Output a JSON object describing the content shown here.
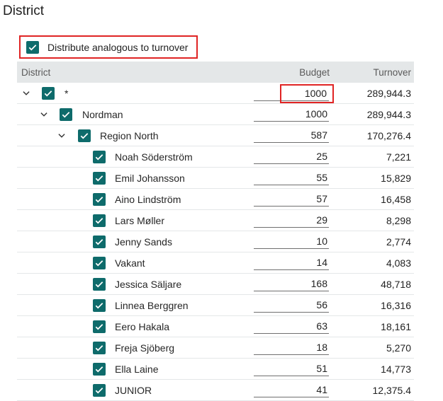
{
  "page": {
    "title": "District"
  },
  "distribute": {
    "label": "Distribute analogous to turnover",
    "checked": true
  },
  "grid": {
    "columns": {
      "district": "District",
      "budget": "Budget",
      "turnover": "Turnover"
    },
    "rows": [
      {
        "name": "*",
        "budget": "1000",
        "turnover": "289,944.3",
        "level": 0,
        "expandable": true,
        "checked": true,
        "highlight": true
      },
      {
        "name": "Nordman",
        "budget": "1000",
        "turnover": "289,944.3",
        "level": 1,
        "expandable": true,
        "checked": true
      },
      {
        "name": "Region North",
        "budget": "587",
        "turnover": "170,276.4",
        "level": 2,
        "expandable": true,
        "checked": true
      },
      {
        "name": "Noah Söderström",
        "budget": "25",
        "turnover": "7,221",
        "level": 3,
        "expandable": false,
        "checked": true
      },
      {
        "name": "Emil Johansson",
        "budget": "55",
        "turnover": "15,829",
        "level": 3,
        "expandable": false,
        "checked": true
      },
      {
        "name": "Aino Lindström",
        "budget": "57",
        "turnover": "16,458",
        "level": 3,
        "expandable": false,
        "checked": true
      },
      {
        "name": "Lars Møller",
        "budget": "29",
        "turnover": "8,298",
        "level": 3,
        "expandable": false,
        "checked": true
      },
      {
        "name": "Jenny Sands",
        "budget": "10",
        "turnover": "2,774",
        "level": 3,
        "expandable": false,
        "checked": true
      },
      {
        "name": "Vakant",
        "budget": "14",
        "turnover": "4,083",
        "level": 3,
        "expandable": false,
        "checked": true
      },
      {
        "name": "Jessica Säljare",
        "budget": "168",
        "turnover": "48,718",
        "level": 3,
        "expandable": false,
        "checked": true
      },
      {
        "name": "Linnea Berggren",
        "budget": "56",
        "turnover": "16,316",
        "level": 3,
        "expandable": false,
        "checked": true
      },
      {
        "name": "Eero Hakala",
        "budget": "63",
        "turnover": "18,161",
        "level": 3,
        "expandable": false,
        "checked": true
      },
      {
        "name": "Freja Sjöberg",
        "budget": "18",
        "turnover": "5,270",
        "level": 3,
        "expandable": false,
        "checked": true
      },
      {
        "name": "Ella Laine",
        "budget": "51",
        "turnover": "14,773",
        "level": 3,
        "expandable": false,
        "checked": true
      },
      {
        "name": "JUNIOR",
        "budget": "41",
        "turnover": "12,375.4",
        "level": 3,
        "expandable": false,
        "checked": true
      }
    ]
  },
  "icons": {
    "checkbox": "check-icon",
    "expand": "chevron-down-icon"
  },
  "colors": {
    "checkbox": "#0e6b6b",
    "highlight": "#e02424",
    "header_bg": "#e4e7e8"
  }
}
